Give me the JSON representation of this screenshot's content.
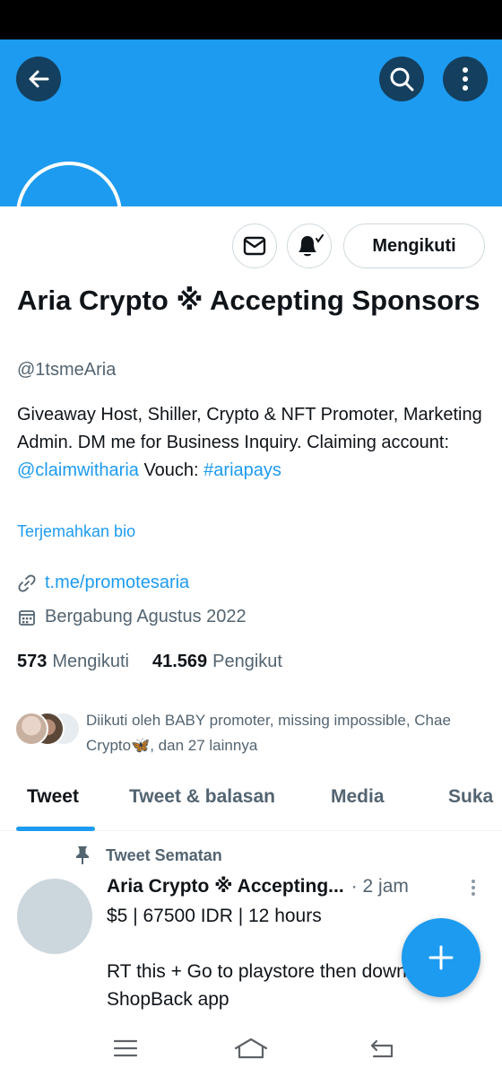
{
  "header": {
    "icons": {
      "back": "arrow-left-icon",
      "search": "search-icon",
      "more": "more-vertical-icon"
    }
  },
  "colors": {
    "brand": "#1d9bf0",
    "text": "#0f1419",
    "secondary": "#536471"
  },
  "profile": {
    "name": "Aria Crypto ※ Accepting Sponsors",
    "handle": "@1tsmeAria",
    "bio": {
      "text1": "Giveaway Host, Shiller, Crypto & NFT Promoter, Marketing Admin. DM me for Business Inquiry. Claiming account: ",
      "mention": "@claimwitharia",
      "text2": " Vouch: ",
      "hashtag": "#ariapays"
    },
    "translate_label": "Terjemahkan bio",
    "website": "t.me/promotesaria",
    "joined": "Bergabung Agustus 2022",
    "following_count": "573",
    "following_label": "Mengikuti",
    "followers_count": "41.569",
    "followers_label": "Pengikut",
    "followed_by": "Diikuti oleh BABY promoter, missing impossible, Chae Crypto🦋, dan 27 lainnya",
    "follow_button": "Mengikuti",
    "action_icons": {
      "message": "mail-icon",
      "notify": "bell-check-icon"
    }
  },
  "tabs": [
    {
      "label": "Tweet",
      "active": true
    },
    {
      "label": "Tweet & balasan",
      "active": false
    },
    {
      "label": "Media",
      "active": false
    },
    {
      "label": "Suka",
      "active": false
    }
  ],
  "pinned_tweet": {
    "pinned_label": "Tweet Sematan",
    "author": "Aria Crypto ※ Accepting...",
    "time": "· 2 jam",
    "body": "$5 | 67500 IDR | 12 hours\n\nRT this + Go to playstore then download\nShopBack app"
  },
  "fab": {
    "icon": "plus-icon"
  },
  "nav": {
    "menu": "menu-icon",
    "home": "home-icon",
    "back": "back-icon"
  }
}
